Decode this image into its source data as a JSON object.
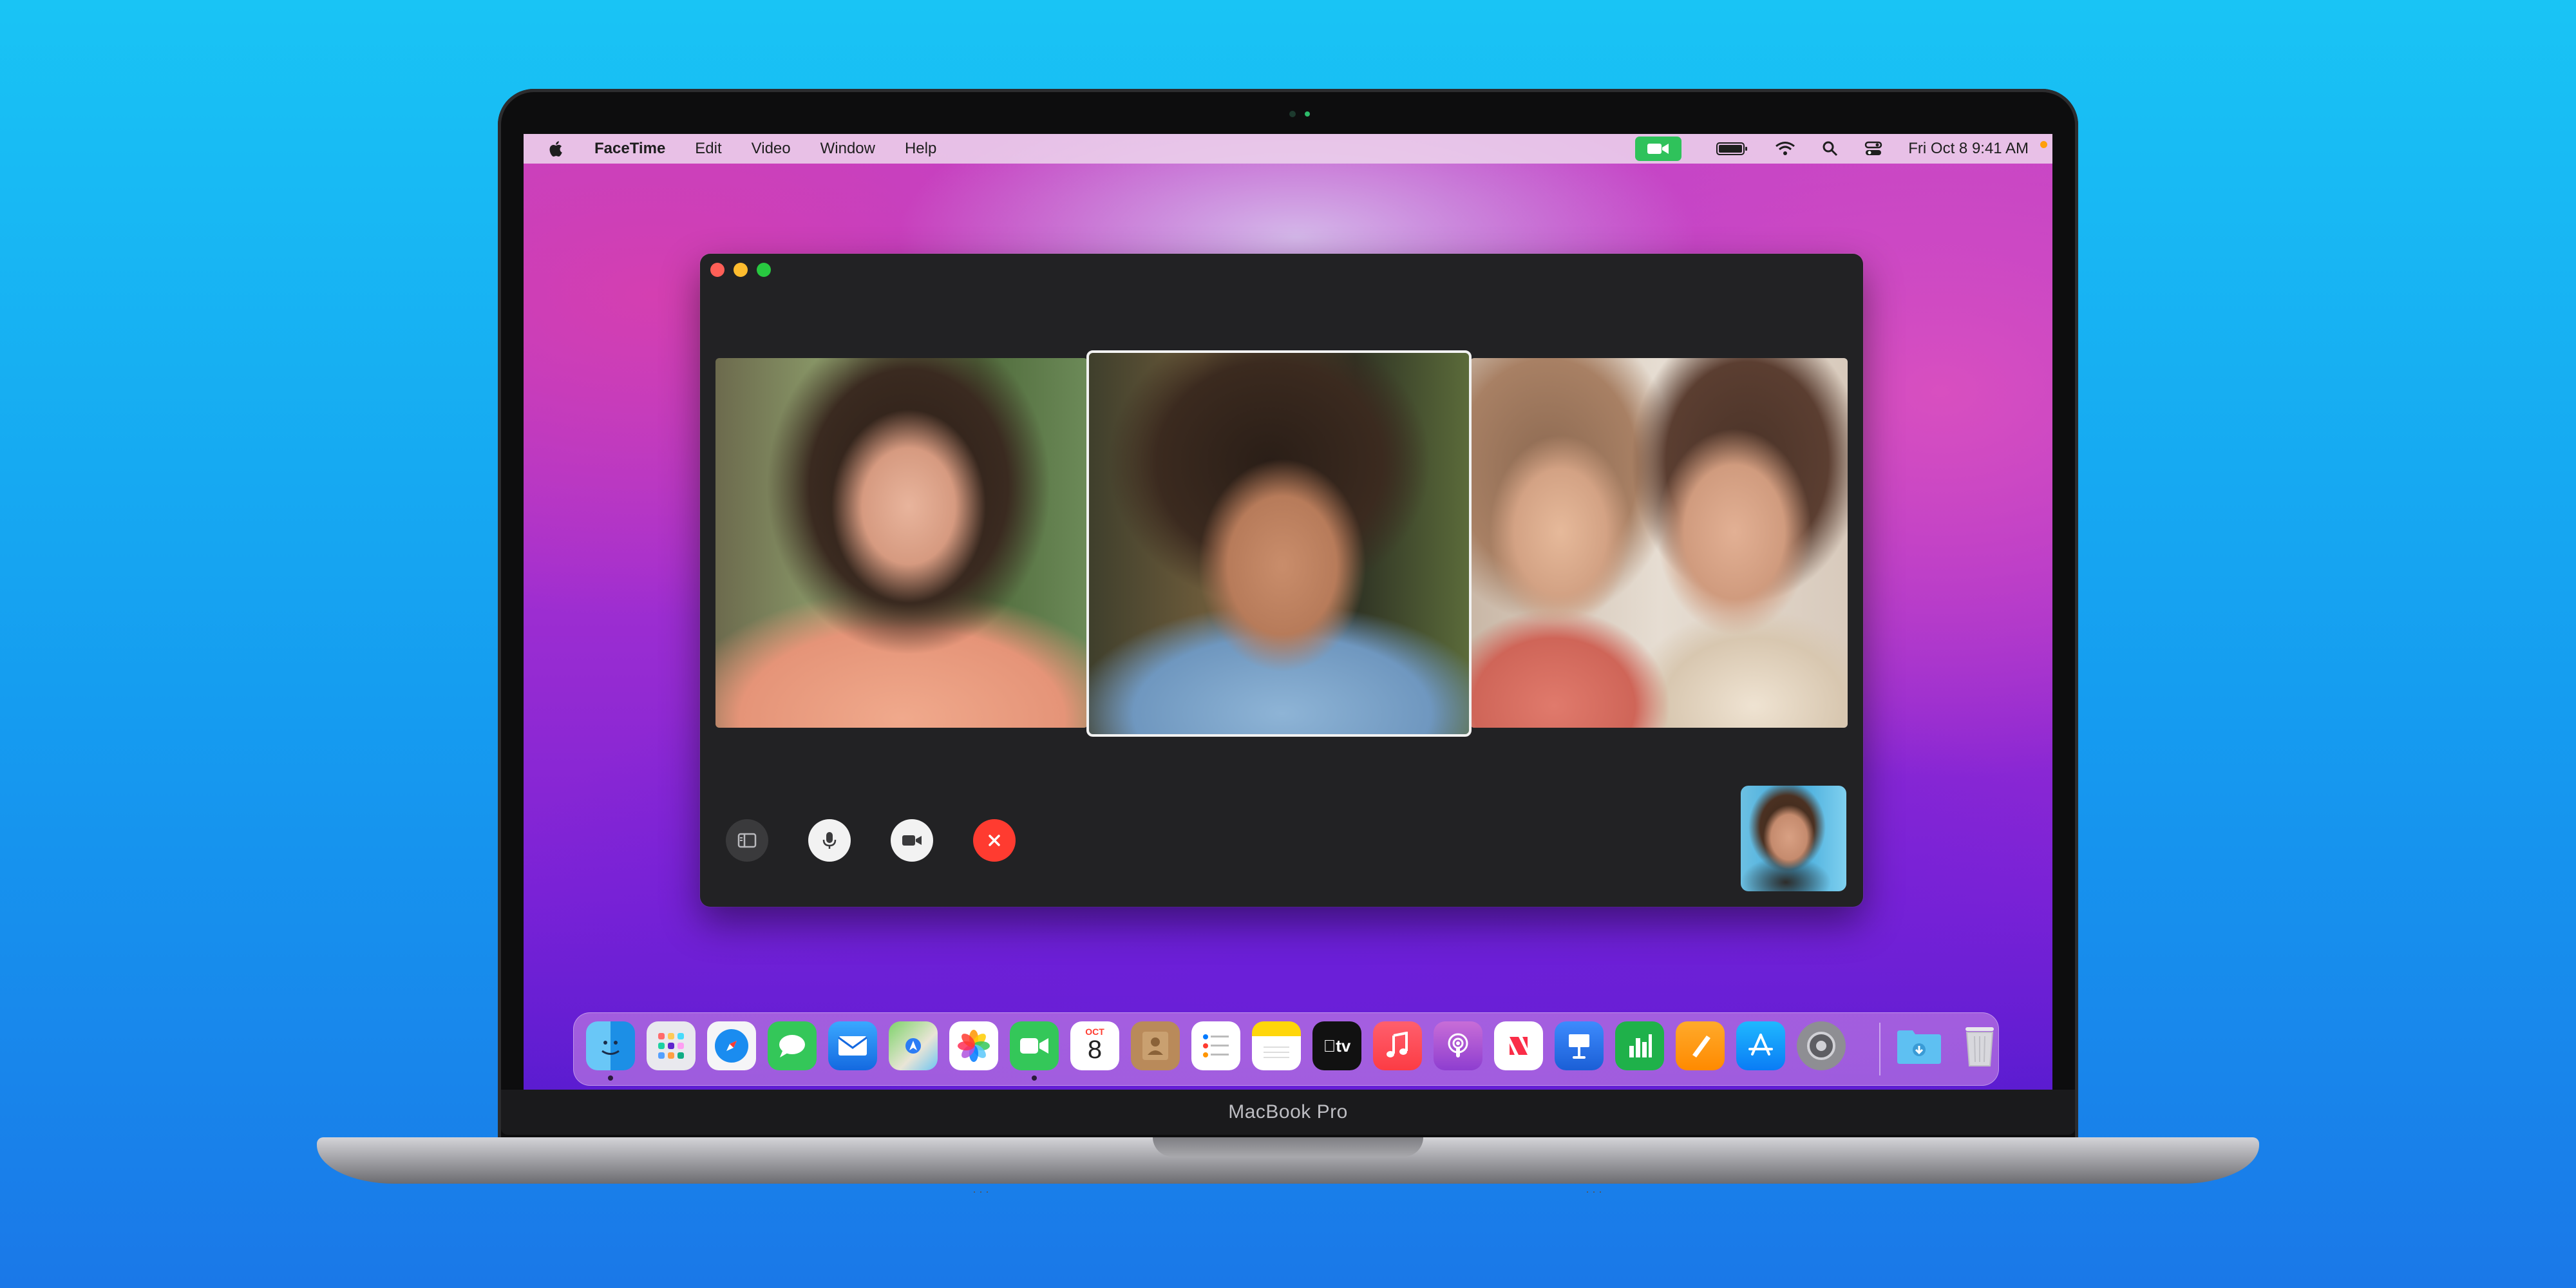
{
  "menubar": {
    "apple_icon": "apple-logo-icon",
    "app_name": "FaceTime",
    "items": [
      "Edit",
      "Video",
      "Window",
      "Help"
    ],
    "clock": "Fri Oct 8  9:41 AM"
  },
  "status_icons": [
    "facetime-video-icon",
    "battery-icon",
    "wifi-icon",
    "search-icon",
    "control-center-icon"
  ],
  "facetime_window": {
    "participants": [
      "participant-left",
      "participant-center-active",
      "participant-right-pair"
    ],
    "controls": [
      "sidebar-toggle",
      "microphone",
      "camera",
      "end-call"
    ]
  },
  "dock": {
    "apps": [
      "Finder",
      "Launchpad",
      "Safari",
      "Messages",
      "Mail",
      "Maps",
      "Photos",
      "FaceTime",
      "Calendar",
      "Contacts",
      "Reminders",
      "Notes",
      "TV",
      "Music",
      "Podcasts",
      "News",
      "Keynote",
      "Numbers",
      "Pages",
      "App Store",
      "System Preferences",
      "Downloads",
      "Trash"
    ],
    "calendar_month": "OCT",
    "calendar_day": "8",
    "tv_label": "tv"
  },
  "laptop": {
    "model_label": "MacBook Pro"
  },
  "colors": {
    "background_top": "#19c4f5",
    "background_bottom": "#1a78e8",
    "end_call": "#ff3b30",
    "facetime_green": "#2fc25b"
  }
}
